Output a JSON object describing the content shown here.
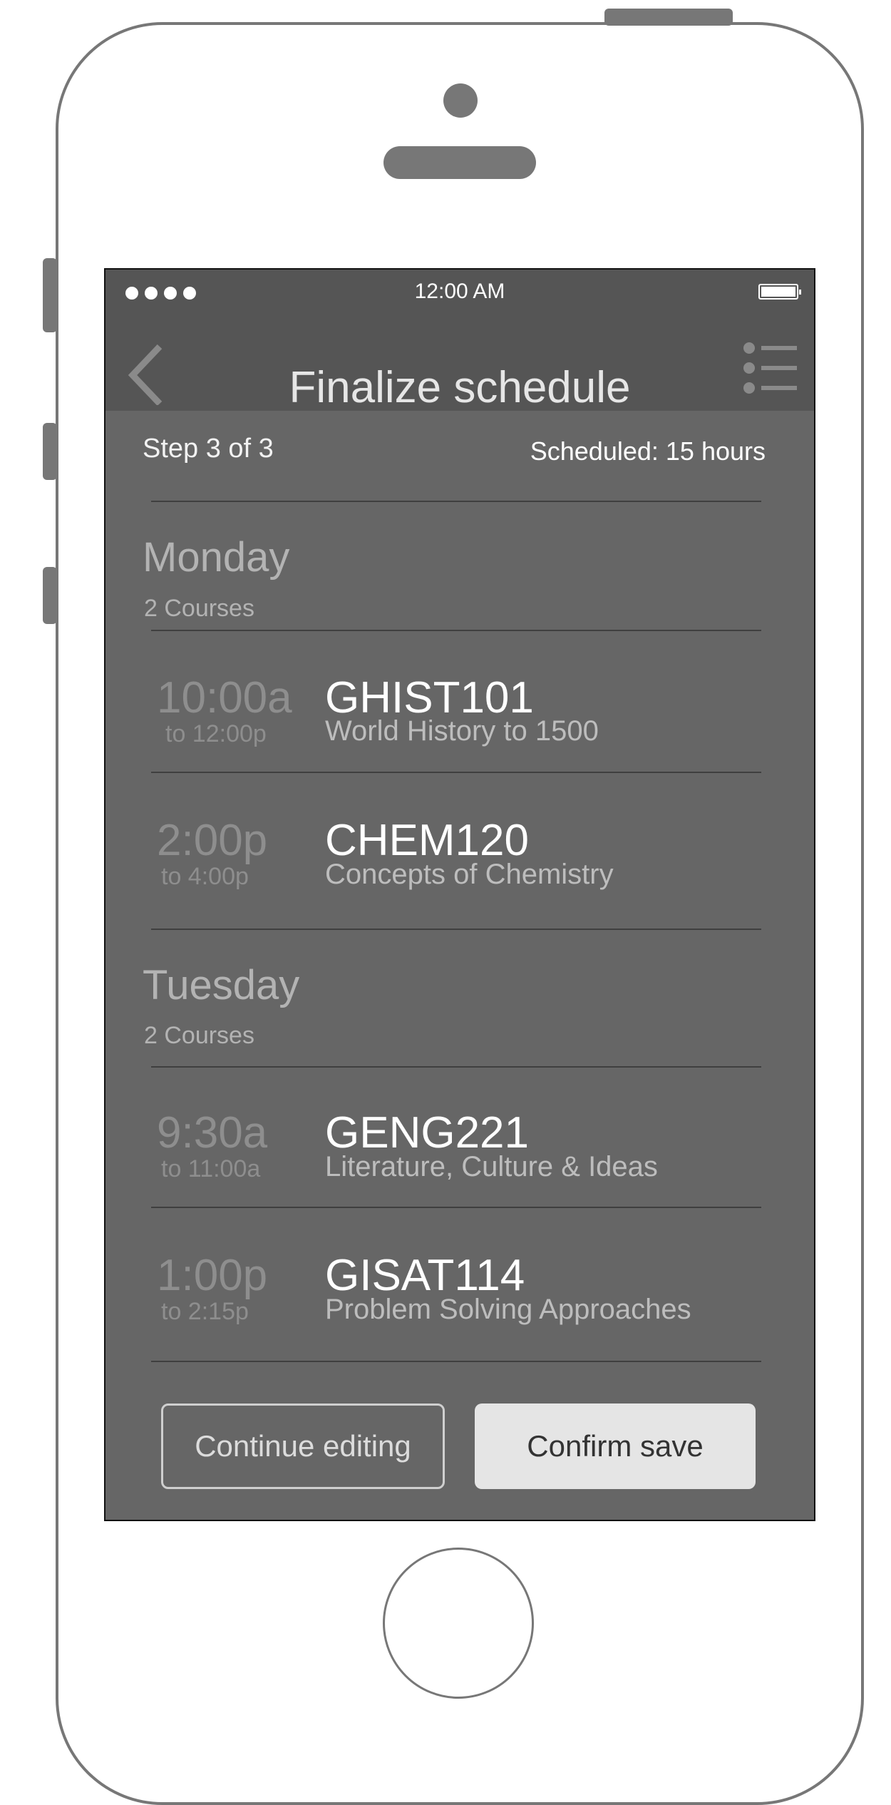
{
  "status_bar": {
    "time": "12:00 AM",
    "signal_icon": "signal-dots-icon",
    "battery_icon": "battery-icon"
  },
  "nav": {
    "title": "Finalize schedule",
    "back_icon": "chevron-left-icon",
    "menu_icon": "list-icon"
  },
  "progress": {
    "step": "Step 3 of 3",
    "scheduled": "Scheduled: 15 hours"
  },
  "days": [
    {
      "name": "Monday",
      "count": "2 Courses",
      "courses": [
        {
          "start": "10:00a",
          "end": "to 12:00p",
          "code": "GHIST101",
          "title": "World History to 1500"
        },
        {
          "start": "2:00p",
          "end": "to 4:00p",
          "code": "CHEM120",
          "title": "Concepts of Chemistry"
        }
      ]
    },
    {
      "name": "Tuesday",
      "count": "2 Courses",
      "courses": [
        {
          "start": "9:30a",
          "end": "to 11:00a",
          "code": "GENG221",
          "title": "Literature, Culture & Ideas"
        },
        {
          "start": "1:00p",
          "end": "to 2:15p",
          "code": "GISAT114",
          "title": "Problem Solving Approaches"
        }
      ]
    }
  ],
  "actions": {
    "continue_label": "Continue editing",
    "confirm_label": "Confirm save"
  },
  "colors": {
    "screen_bg": "#666666",
    "bar_bg": "#555555",
    "frame": "#777777",
    "confirm_bg": "#e5e5e5"
  }
}
